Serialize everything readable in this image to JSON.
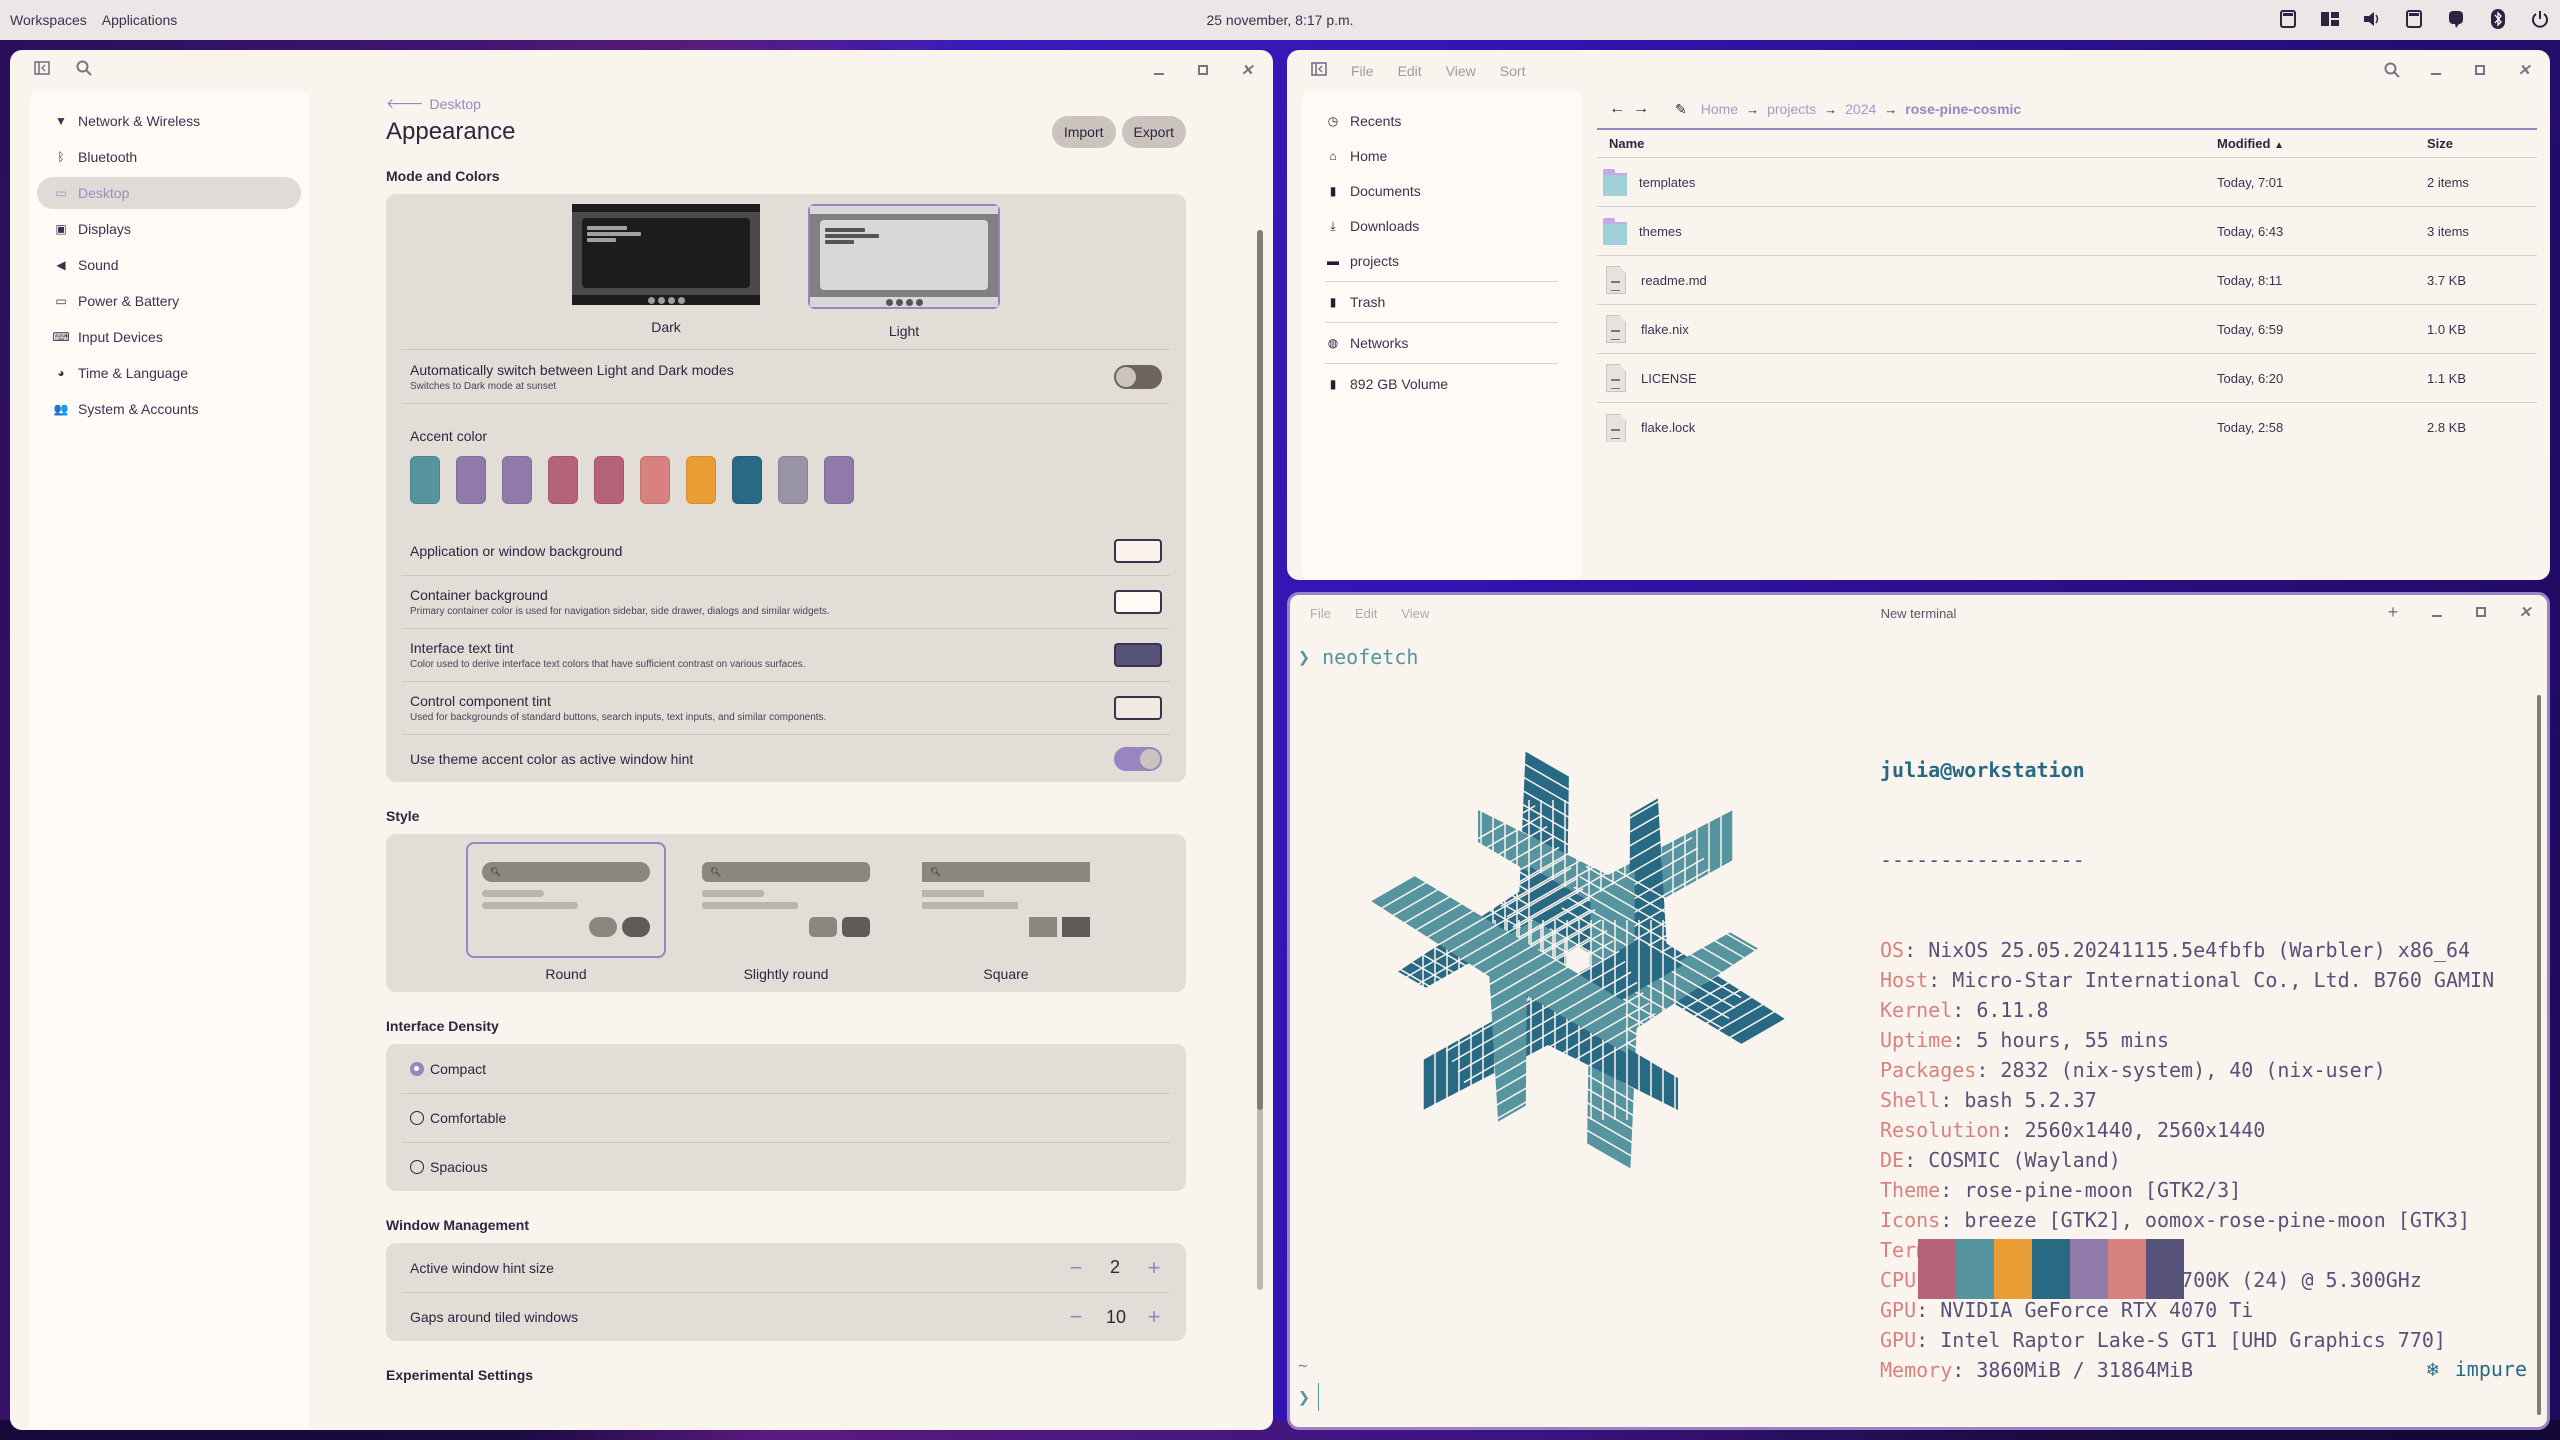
{
  "panel": {
    "workspaces": "Workspaces",
    "applications": "Applications",
    "clock": "25 november, 8:17 p.m.",
    "tray_icons": [
      "display-icon",
      "tiling-icon",
      "volume-icon",
      "display-icon-2",
      "notification-icon",
      "bluetooth-icon",
      "power-icon"
    ]
  },
  "settings": {
    "nav": [
      {
        "label": "Network & Wireless",
        "icon": "wifi-icon",
        "glyph": "▼"
      },
      {
        "label": "Bluetooth",
        "icon": "bluetooth-icon",
        "glyph": "ᛒ"
      },
      {
        "label": "Desktop",
        "icon": "desktop-icon",
        "glyph": "▭",
        "active": true
      },
      {
        "label": "Displays",
        "icon": "displays-icon",
        "glyph": "▣"
      },
      {
        "label": "Sound",
        "icon": "sound-icon",
        "glyph": "◀"
      },
      {
        "label": "Power & Battery",
        "icon": "battery-icon",
        "glyph": "▭"
      },
      {
        "label": "Input Devices",
        "icon": "keyboard-icon",
        "glyph": "⌨"
      },
      {
        "label": "Time & Language",
        "icon": "time-language-icon",
        "glyph": "◕"
      },
      {
        "label": "System & Accounts",
        "icon": "accounts-icon",
        "glyph": "👥"
      }
    ],
    "breadcrumb_back": "Desktop",
    "title": "Appearance",
    "import_label": "Import",
    "export_label": "Export",
    "mode_section": "Mode and Colors",
    "modes": [
      {
        "label": "Dark",
        "selected": false
      },
      {
        "label": "Light",
        "selected": true
      }
    ],
    "auto_switch": {
      "label": "Automatically switch between Light and Dark modes",
      "sub": "Switches to Dark mode at sunset",
      "enabled": false
    },
    "accent_label": "Accent color",
    "accent_colors": [
      "#56949f",
      "#907aa9",
      "#907aa9",
      "#b4637a",
      "#b4637a",
      "#d7827e",
      "#ea9d34",
      "#286983",
      "#9893a5",
      "#907aa9"
    ],
    "color_rows": [
      {
        "label": "Application or window background",
        "sub": "",
        "color": "#faf4ed"
      },
      {
        "label": "Container background",
        "sub": "Primary container color is used for navigation sidebar, side drawer, dialogs and similar widgets.",
        "color": "#fffaf3"
      },
      {
        "label": "Interface text tint",
        "sub": "Color used to derive interface text colors that have sufficient contrast on various surfaces.",
        "color": "#575279"
      },
      {
        "label": "Control component tint",
        "sub": "Used for backgrounds of standard buttons, search inputs, text inputs, and similar components.",
        "color": "#f2e9e1"
      }
    ],
    "accent_hint": {
      "label": "Use theme accent color as active window hint",
      "enabled": true
    },
    "style_section": "Style",
    "styles": [
      {
        "label": "Round",
        "selected": true
      },
      {
        "label": "Slightly round",
        "selected": false
      },
      {
        "label": "Square",
        "selected": false
      }
    ],
    "density_section": "Interface Density",
    "density": [
      {
        "label": "Compact",
        "selected": true
      },
      {
        "label": "Comfortable",
        "selected": false
      },
      {
        "label": "Spacious",
        "selected": false
      }
    ],
    "wm_section": "Window Management",
    "wm": [
      {
        "label": "Active window hint size",
        "value": "2"
      },
      {
        "label": "Gaps around tiled windows",
        "value": "10"
      }
    ],
    "experimental_section": "Experimental Settings"
  },
  "files": {
    "menu": [
      "File",
      "Edit",
      "View",
      "Sort"
    ],
    "sidebar": [
      {
        "label": "Recents",
        "icon": "clock-icon",
        "glyph": "◷"
      },
      {
        "label": "Home",
        "icon": "home-icon",
        "glyph": "⌂"
      },
      {
        "label": "Documents",
        "icon": "document-icon",
        "glyph": "▮"
      },
      {
        "label": "Downloads",
        "icon": "download-icon",
        "glyph": "⤓"
      },
      {
        "label": "projects",
        "icon": "folder-icon",
        "glyph": "▬"
      },
      {
        "label": "Trash",
        "icon": "trash-icon",
        "glyph": "▮",
        "sep_before": true
      },
      {
        "label": "Networks",
        "icon": "globe-icon",
        "glyph": "◍",
        "sep_before": true
      },
      {
        "label": "892 GB Volume",
        "icon": "drive-icon",
        "glyph": "▮",
        "sep_before": true
      }
    ],
    "breadcrumb": [
      "Home",
      "projects",
      "2024"
    ],
    "breadcrumb_current": "rose-pine-cosmic",
    "columns": {
      "name": "Name",
      "modified": "Modified",
      "size": "Size",
      "sort_indicator": "▲"
    },
    "rows": [
      {
        "name": "templates",
        "type": "folder",
        "modified": "Today, 7:01",
        "size": "2 items"
      },
      {
        "name": "themes",
        "type": "folder",
        "modified": "Today, 6:43",
        "size": "3 items"
      },
      {
        "name": "readme.md",
        "type": "file",
        "modified": "Today, 8:11",
        "size": "3.7 KB"
      },
      {
        "name": "flake.nix",
        "type": "file",
        "modified": "Today, 6:59",
        "size": "1.0 KB"
      },
      {
        "name": "LICENSE",
        "type": "file",
        "modified": "Today, 6:20",
        "size": "1.1 KB"
      },
      {
        "name": "flake.lock",
        "type": "file",
        "modified": "Today, 2:58",
        "size": "2.8 KB"
      }
    ]
  },
  "terminal": {
    "menu": [
      "File",
      "Edit",
      "View"
    ],
    "title": "New terminal",
    "prompt_symbol": "❯",
    "command": "neofetch",
    "user_host": "julia@workstation",
    "separator": "-----------------",
    "info": [
      {
        "key": "OS",
        "value": "NixOS 25.05.20241115.5e4fbfb (Warbler) x86_64"
      },
      {
        "key": "Host",
        "value": "Micro-Star International Co., Ltd. B760 GAMIN"
      },
      {
        "key": "Kernel",
        "value": "6.11.8"
      },
      {
        "key": "Uptime",
        "value": "5 hours, 55 mins"
      },
      {
        "key": "Packages",
        "value": "2832 (nix-system), 40 (nix-user)"
      },
      {
        "key": "Shell",
        "value": "bash 5.2.37"
      },
      {
        "key": "Resolution",
        "value": "2560x1440, 2560x1440"
      },
      {
        "key": "DE",
        "value": "COSMIC (Wayland)"
      },
      {
        "key": "Theme",
        "value": "rose-pine-moon [GTK2/3]"
      },
      {
        "key": "Icons",
        "value": "breeze [GTK2], oomox-rose-pine-moon [GTK3]"
      },
      {
        "key": "Terminal",
        "value": ","
      },
      {
        "key": "CPU",
        "value": "13th Gen Intel i7-13700K (24) @ 5.300GHz"
      },
      {
        "key": "GPU",
        "value": "NVIDIA GeForce RTX 4070 Ti"
      },
      {
        "key": "GPU",
        "value": "Intel Raptor Lake-S GT1 [UHD Graphics 770]"
      },
      {
        "key": "Memory",
        "value": "3860MiB / 31864MiB"
      }
    ],
    "palette": [
      "#b4637a",
      "#56949f",
      "#ea9d34",
      "#286983",
      "#907aa9",
      "#d7827e",
      "#575279"
    ],
    "logo_colors": {
      "dark": "#286983",
      "light": "#56949f"
    },
    "cwd": "~",
    "status_icon": "❄",
    "status_text": "impure"
  }
}
